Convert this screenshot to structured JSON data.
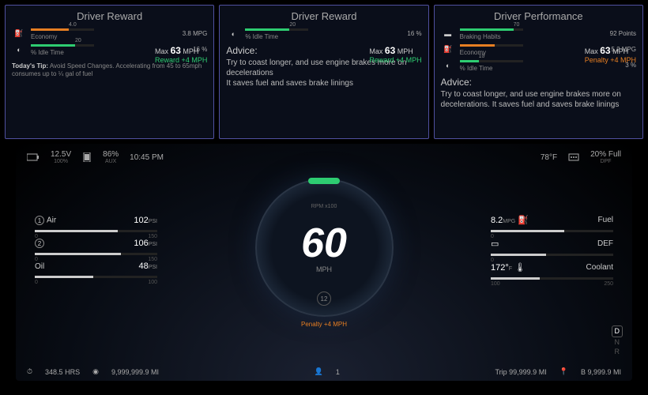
{
  "cards": [
    {
      "title": "Driver Reward",
      "metrics": [
        {
          "icon": "fuel",
          "label": "Economy",
          "target": "4.0",
          "value": "3.8 MPG",
          "fill": 60,
          "color": "orange"
        },
        {
          "icon": "idle",
          "label": "% Idle Time",
          "target": "20",
          "value": "16 %",
          "fill": 70,
          "color": "green"
        }
      ],
      "max": {
        "label": "Max",
        "value": "63",
        "unit": "MPH"
      },
      "bonus": {
        "label": "Reward +4 MPH",
        "type": "reward"
      },
      "tip": {
        "head": "Today's Tip:",
        "body": "Avoid Speed Changes. Accelerating from 45 to 65mph consumes up to ¼ gal of fuel"
      }
    },
    {
      "title": "Driver Reward",
      "metrics": [
        {
          "icon": "idle",
          "label": "% Idle Time",
          "target": "20",
          "value": "16 %",
          "fill": 70,
          "color": "green"
        }
      ],
      "max": {
        "label": "Max",
        "value": "63",
        "unit": "MPH"
      },
      "bonus": {
        "label": "Reward +4 MPH",
        "type": "reward"
      },
      "advice": {
        "head": "Advice:",
        "body": "Try to coast longer, and use engine brakes more on decelerations\nIt saves fuel and saves brake linings"
      }
    },
    {
      "title": "Driver Performance",
      "metrics": [
        {
          "icon": "brake",
          "label": "Braking Habits",
          "target": "70",
          "value": "92 Points",
          "fill": 85,
          "color": "green"
        },
        {
          "icon": "fuel",
          "label": "Economy",
          "target": "",
          "value": "5.2 MPG",
          "fill": 55,
          "color": "orange"
        },
        {
          "icon": "idle",
          "label": "% Idle Time",
          "target": "10",
          "value": "3 %",
          "fill": 30,
          "color": "green"
        }
      ],
      "max": {
        "label": "Max",
        "value": "63",
        "unit": "MPH"
      },
      "bonus": {
        "label": "Penalty +4 MPH",
        "type": "penalty"
      },
      "advice": {
        "head": "Advice:",
        "body": "Try to coast longer, and use engine brakes more on decelerations. It saves fuel and saves brake linings"
      }
    }
  ],
  "dash": {
    "top": {
      "battery": {
        "voltage": "12.5V",
        "pct": "100%"
      },
      "aux": {
        "pct": "86%",
        "label": "AUX"
      },
      "time": "10:45 PM",
      "temp": "78°F",
      "dpf": {
        "pct": "20% Full",
        "label": "DPF"
      }
    },
    "left": [
      {
        "icon": "①",
        "label": "Air",
        "value": "102",
        "unit": "PSI",
        "max": "150",
        "fill": 68,
        "red": true
      },
      {
        "icon": "②",
        "label": "",
        "value": "106",
        "unit": "PSI",
        "max": "150",
        "fill": 70,
        "red": true
      },
      {
        "icon": "oil",
        "label": "Oil",
        "value": "48",
        "unit": "PSI",
        "max": "100",
        "fill": 48,
        "red": false
      }
    ],
    "right": [
      {
        "icon": "fuel",
        "label": "Fuel",
        "value": "8.2",
        "unit": "MPG",
        "fill": 60
      },
      {
        "icon": "def",
        "label": "DEF",
        "value": "",
        "unit": "",
        "fill": 45
      },
      {
        "icon": "coolant",
        "label": "Coolant",
        "value": "172°",
        "unit": "F",
        "min": "100",
        "max": "250",
        "fill": 40
      }
    ],
    "speedo": {
      "rpm_label": "RPM x100",
      "speed": "60",
      "unit": "MPH",
      "gear": "12",
      "penalty": "Penalty",
      "penalty_val": "+4 MPH"
    },
    "gearind": {
      "options": [
        "D",
        "N",
        "R"
      ],
      "current": "D"
    },
    "bottom": {
      "hours": {
        "value": "348.5",
        "unit": "HRS"
      },
      "odo": {
        "value": "9,999,999.9",
        "unit": "MI"
      },
      "occupants": "1",
      "trip": {
        "label": "Trip",
        "value": "99,999.9",
        "unit": "MI"
      },
      "tripB": {
        "label": "B",
        "value": "9,999.9",
        "unit": "MI"
      }
    }
  }
}
